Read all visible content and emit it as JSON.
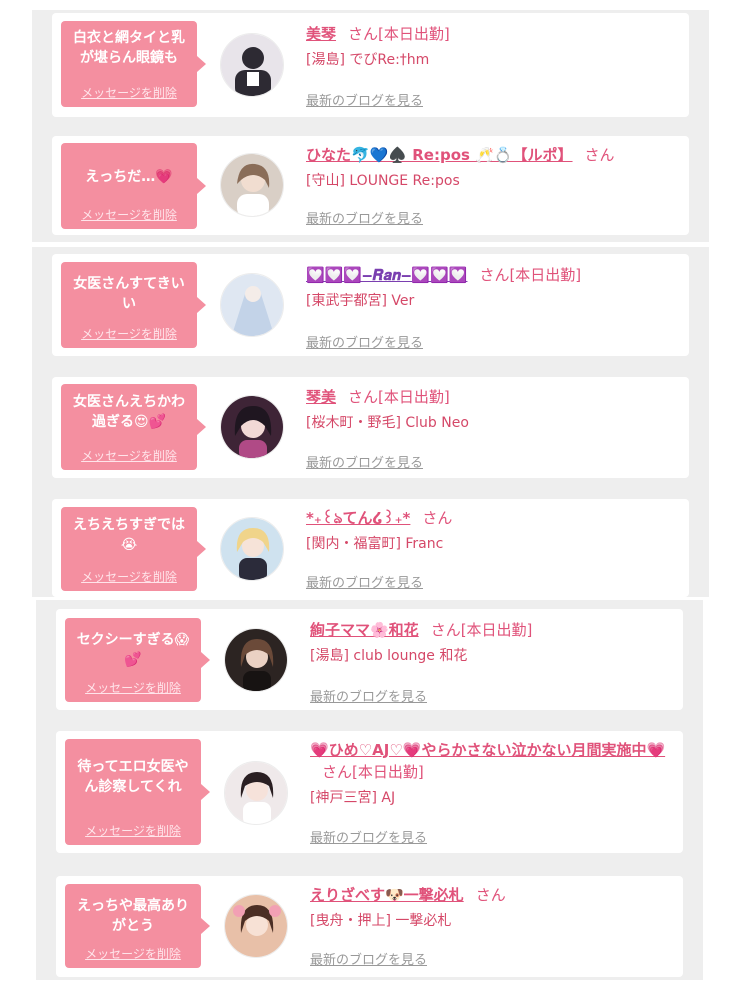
{
  "items": [
    {
      "message": "白衣と網タイと乳が堪らん眼鏡も",
      "delete_label": "メッセージを削除",
      "name": "美琴",
      "suffix": "さん[本日出勤]",
      "shop": "[湯島] でびRe:†hm",
      "blog_label": "最新のブログを見る",
      "avatar_color": "#3a3a46"
    },
    {
      "message": "えっちだ…💗",
      "delete_label": "メッセージを削除",
      "name": "ひなた🐬💙♠️ Re:pos 🥂💍【ルポ】",
      "suffix": "さん",
      "shop": "[守山] LOUNGE Re:pos",
      "blog_label": "最新のブログを見る",
      "avatar_color": "#cdb9a8"
    },
    {
      "message": "女医さんすてきいい",
      "delete_label": "メッセージを削除",
      "name": "💟💟💟‒𝑹𝒂𝒏‒💟💟💟",
      "suffix": "さん[本日出勤]",
      "shop": "[東武宇都宮] Ver",
      "blog_label": "最新のブログを見る",
      "avatar_color": "#c9d8ea"
    },
    {
      "message": "女医さんえちかわ過ぎる😍💕",
      "delete_label": "メッセージを削除",
      "name": "琴美",
      "suffix": "さん[本日出勤]",
      "shop": "[桜木町・野毛] Club Neo",
      "blog_label": "最新のブログを見る",
      "avatar_color": "#4a2a3c"
    },
    {
      "message": "えちえちすぎでは😭",
      "delete_label": "メッセージを削除",
      "name": "*₊꒰ঌてん໒꒱₊*",
      "suffix": "さん",
      "shop": "[関内・福富町] Franc",
      "blog_label": "最新のブログを見る",
      "avatar_color": "#bcd6e8"
    },
    {
      "message": "セクシーすぎる😱💕",
      "delete_label": "メッセージを削除",
      "name": "絢子ママ🌸和花",
      "suffix": "さん[本日出勤]",
      "shop": "[湯島] club lounge 和花",
      "blog_label": "最新のブログを見る",
      "avatar_color": "#3b2f2b"
    },
    {
      "message": "待ってエロ女医やん診察してくれ",
      "delete_label": "メッセージを削除",
      "name": "💗ひめ♡AJ♡💗やらかさない泣かない月間実施中💗",
      "suffix": "さん[本日出勤]",
      "shop": "[神戸三宮] AJ",
      "blog_label": "最新のブログを見る",
      "avatar_color": "#e9e2e4"
    },
    {
      "message": "えっちや最高ありがとう",
      "delete_label": "メッセージを削除",
      "name": "えりざべす🐶一撃必札",
      "suffix": "さん",
      "shop": "[曳舟・押上] 一撃必札",
      "blog_label": "最新のブログを見る",
      "avatar_color": "#d7a58a"
    }
  ]
}
